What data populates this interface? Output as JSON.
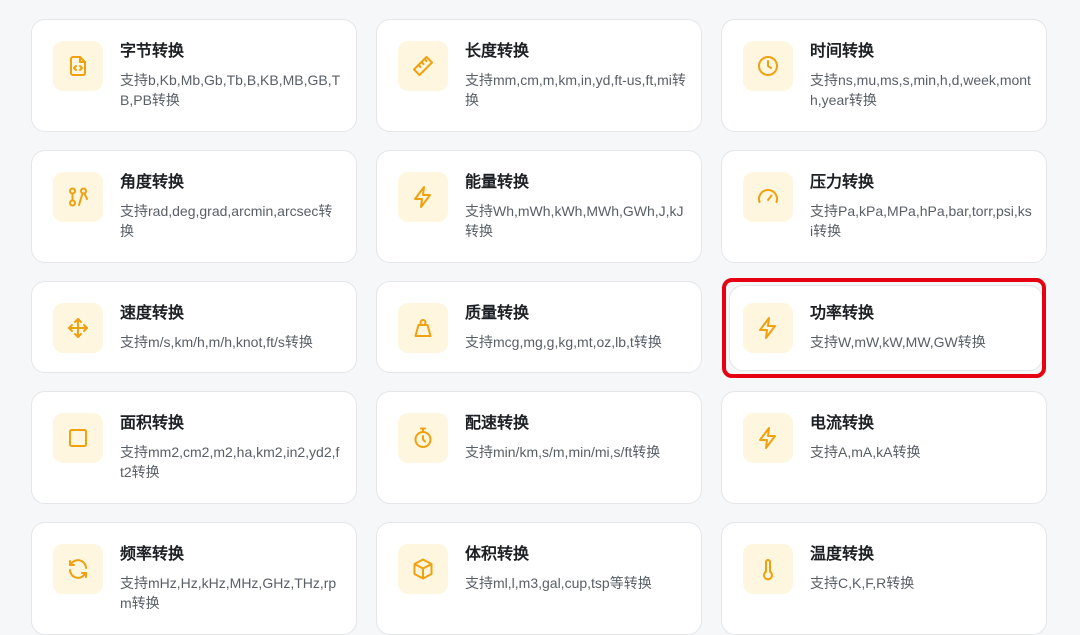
{
  "accent_color": "#f0a10f",
  "highlight_color": "#e60012",
  "cards": [
    {
      "title": "字节转换",
      "desc": "支持b,Kb,Mb,Gb,Tb,B,KB,MB,GB,TB,PB转换",
      "icon": "file-code-icon"
    },
    {
      "title": "长度转换",
      "desc": "支持mm,cm,m,km,in,yd,ft-us,ft,mi转换",
      "icon": "ruler-icon"
    },
    {
      "title": "时间转换",
      "desc": "支持ns,mu,ms,s,min,h,d,week,month,year转换",
      "icon": "clock-icon"
    },
    {
      "title": "角度转换",
      "desc": "支持rad,deg,grad,arcmin,arcsec转换",
      "icon": "compass-icon"
    },
    {
      "title": "能量转换",
      "desc": "支持Wh,mWh,kWh,MWh,GWh,J,kJ转换",
      "icon": "lightning-icon"
    },
    {
      "title": "压力转换",
      "desc": "支持Pa,kPa,MPa,hPa,bar,torr,psi,ksi转换",
      "icon": "gauge-icon"
    },
    {
      "title": "速度转换",
      "desc": "支持m/s,km/h,m/h,knot,ft/s转换",
      "icon": "move-arrows-icon"
    },
    {
      "title": "质量转换",
      "desc": "支持mcg,mg,g,kg,mt,oz,lb,t转换",
      "icon": "weight-icon"
    },
    {
      "title": "功率转换",
      "desc": "支持W,mW,kW,MW,GW转换",
      "icon": "lightning-icon"
    },
    {
      "title": "面积转换",
      "desc": "支持mm2,cm2,m2,ha,km2,in2,yd2,ft2转换",
      "icon": "square-icon"
    },
    {
      "title": "配速转换",
      "desc": "支持min/km,s/m,min/mi,s/ft转换",
      "icon": "stopwatch-icon"
    },
    {
      "title": "电流转换",
      "desc": "支持A,mA,kA转换",
      "icon": "lightning-icon"
    },
    {
      "title": "频率转换",
      "desc": "支持mHz,Hz,kHz,MHz,GHz,THz,rpm转换",
      "icon": "refresh-icon"
    },
    {
      "title": "体积转换",
      "desc": "支持ml,l,m3,gal,cup,tsp等转换",
      "icon": "cube-icon"
    },
    {
      "title": "温度转换",
      "desc": "支持C,K,F,R转换",
      "icon": "thermometer-icon"
    }
  ]
}
